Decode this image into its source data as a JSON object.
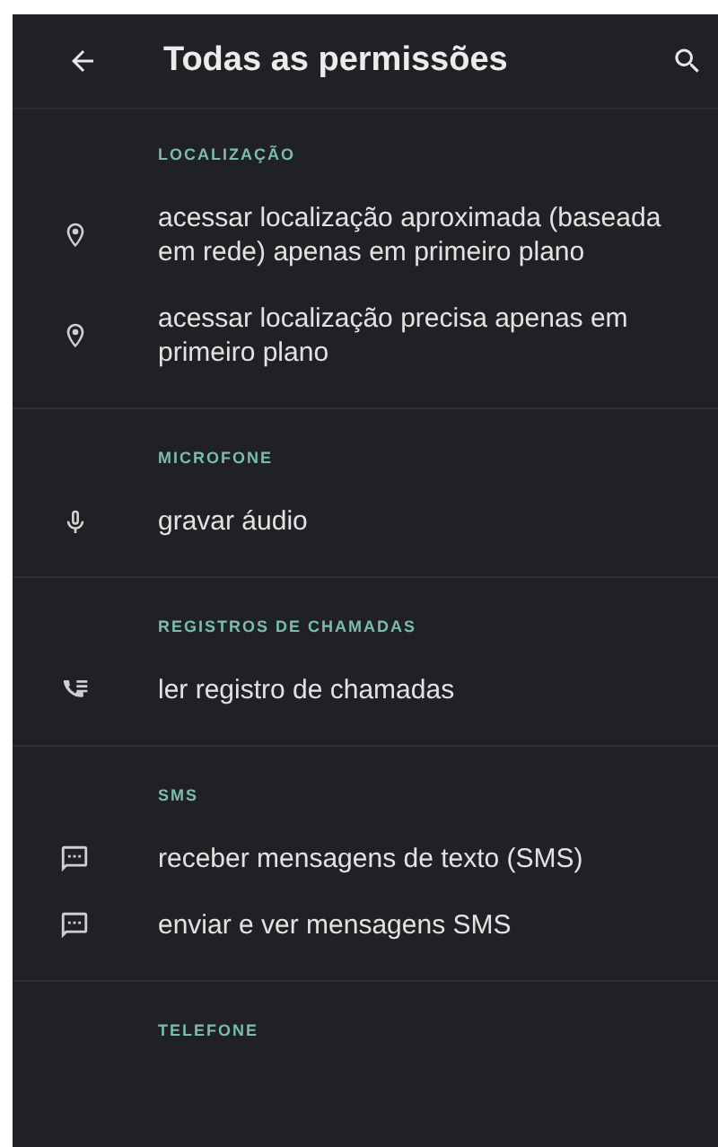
{
  "app_bar": {
    "title": "Todas as permissões"
  },
  "sections": [
    {
      "title": "LOCALIZAÇÃO",
      "items": [
        {
          "kind": "location",
          "label": "acessar localização aproximada (baseada em rede) apenas em primeiro plano"
        },
        {
          "kind": "location",
          "label": "acessar localização precisa apenas em primeiro plano"
        }
      ]
    },
    {
      "title": "MICROFONE",
      "items": [
        {
          "kind": "mic",
          "label": "gravar áudio"
        }
      ]
    },
    {
      "title": "REGISTROS DE CHAMADAS",
      "items": [
        {
          "kind": "call-log",
          "label": "ler registro de chamadas"
        }
      ]
    },
    {
      "title": "SMS",
      "items": [
        {
          "kind": "message",
          "label": "receber mensagens de texto (SMS)"
        },
        {
          "kind": "message",
          "label": "enviar e ver mensagens SMS"
        }
      ]
    },
    {
      "title": "TELEFONE"
    }
  ]
}
